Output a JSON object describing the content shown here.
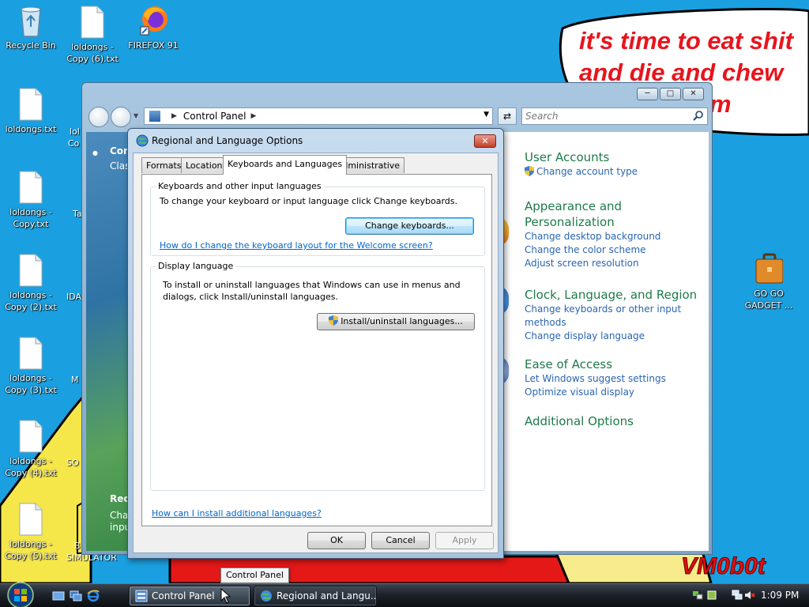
{
  "desktop": {
    "wallpaper_text": {
      "line1": "it's time to eat shit",
      "line2": "and die and chew",
      "line3": "m"
    },
    "signature": "VM0b0t",
    "icons": [
      {
        "label": "Recycle Bin",
        "icon": "recycle-bin-icon"
      },
      {
        "label": "loldongs - Copy (6).txt",
        "icon": "text-file-icon"
      },
      {
        "label": "FIREFOX 91",
        "icon": "firefox-icon"
      },
      {
        "label": "loldongs.txt",
        "icon": "text-file-icon"
      },
      {
        "label": "loldongs - Copy.txt",
        "icon": "text-file-icon"
      },
      {
        "label": "loldongs - Copy (2).txt",
        "icon": "text-file-icon"
      },
      {
        "label": "loldongs - Copy (3).txt",
        "icon": "text-file-icon"
      },
      {
        "label": "loldongs - Copy (4).txt",
        "icon": "text-file-icon"
      },
      {
        "label": "loldongs - Copy (5).txt",
        "icon": "text-file-icon"
      },
      {
        "label": "GO GO GADGET ...",
        "icon": "briefcase-icon"
      }
    ],
    "partial_labels": [
      "lol",
      "Co",
      "Ta",
      "IDA",
      "M",
      "SO",
      "B",
      "SIMULATOR"
    ]
  },
  "control_panel": {
    "address": "Control Panel",
    "search_placeholder": "Search",
    "left_pane": {
      "heading": "Con",
      "sub": "Clas",
      "heading2": "Rec",
      "sub2a": "Cha",
      "sub2b": "inpu"
    },
    "categories": [
      {
        "title": "User Accounts",
        "links": [
          "Change account type"
        ]
      },
      {
        "title": "Appearance and Personalization",
        "links": [
          "Change desktop background",
          "Change the color scheme",
          "Adjust screen resolution"
        ]
      },
      {
        "title": "Clock, Language, and Region",
        "links": [
          "Change keyboards or other input methods",
          "Change display language"
        ]
      },
      {
        "title": "Ease of Access",
        "links": [
          "Let Windows suggest settings",
          "Optimize visual display"
        ]
      },
      {
        "title": "Additional Options",
        "links": []
      }
    ]
  },
  "dialog": {
    "title": "Regional and Language Options",
    "tabs": [
      "Formats",
      "Location",
      "Keyboards and Languages",
      "Administrative"
    ],
    "active_tab": "Keyboards and Languages",
    "keyboards_group": {
      "title": "Keyboards and other input languages",
      "text": "To change your keyboard or input language click Change keyboards.",
      "button": "Change keyboards...",
      "link": "How do I change the keyboard layout for the Welcome screen?"
    },
    "display_group": {
      "title": "Display language",
      "text_line1": "To install or uninstall languages that Windows can use in menus and",
      "text_line2": "dialogs, click Install/uninstall languages.",
      "button": "Install/uninstall languages..."
    },
    "bottom_link": "How can I install additional languages?",
    "buttons": {
      "ok": "OK",
      "cancel": "Cancel",
      "apply": "Apply"
    }
  },
  "tooltip": "Control Panel",
  "taskbar": {
    "tasks": [
      {
        "label": "Control Panel",
        "active": true
      },
      {
        "label": "Regional and Langu...",
        "active": false
      }
    ],
    "clock": "1:09 PM"
  },
  "colors": {
    "desktop": "#1aa0e0",
    "category_title": "#1e7a4a",
    "link": "#2a65b0",
    "wallpaper_text": "#e8141c"
  }
}
